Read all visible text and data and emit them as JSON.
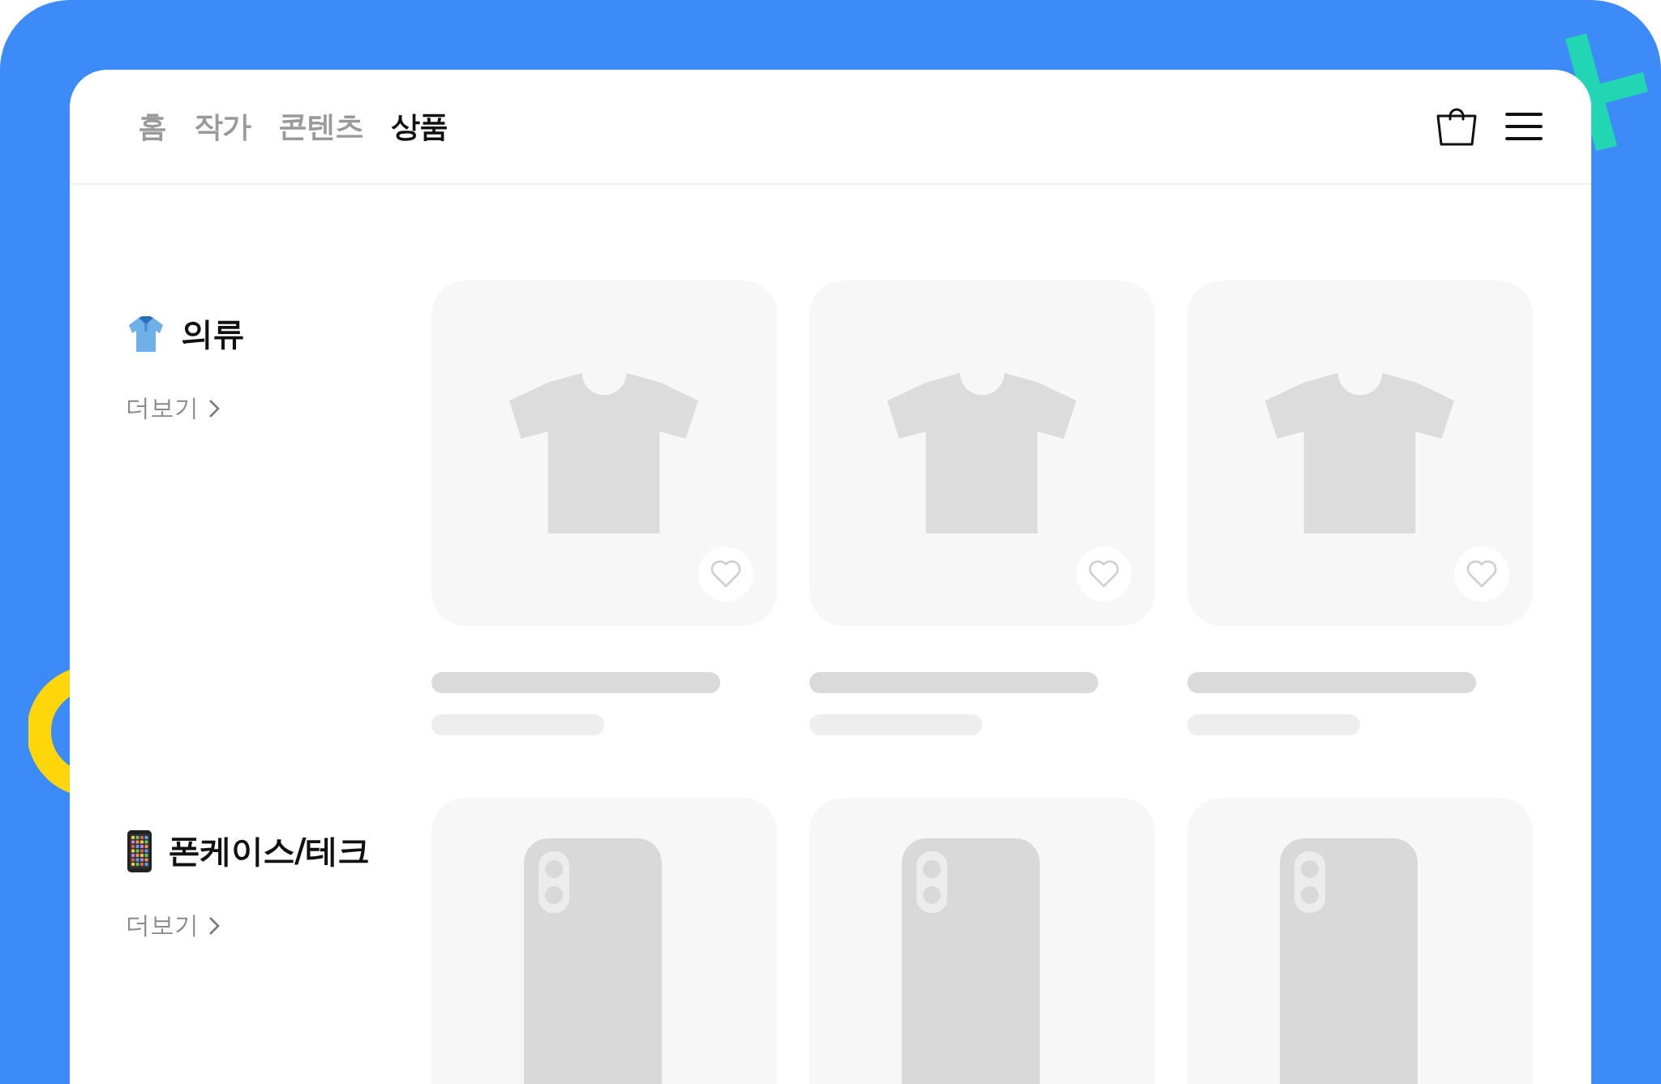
{
  "nav": {
    "tabs": [
      {
        "label": "홈",
        "selected": false
      },
      {
        "label": "작가",
        "selected": false
      },
      {
        "label": "콘텐츠",
        "selected": false
      },
      {
        "label": "상품",
        "selected": true
      }
    ]
  },
  "sections": [
    {
      "kind": "clothing",
      "title": "의류",
      "more": "더보기",
      "products": [
        {
          "kind": "shirt"
        },
        {
          "kind": "shirt"
        },
        {
          "kind": "shirt"
        }
      ]
    },
    {
      "kind": "tech",
      "title": "폰케이스/테크",
      "more": "더보기",
      "products": [
        {
          "kind": "phone"
        },
        {
          "kind": "phone"
        },
        {
          "kind": "phone"
        }
      ]
    }
  ]
}
